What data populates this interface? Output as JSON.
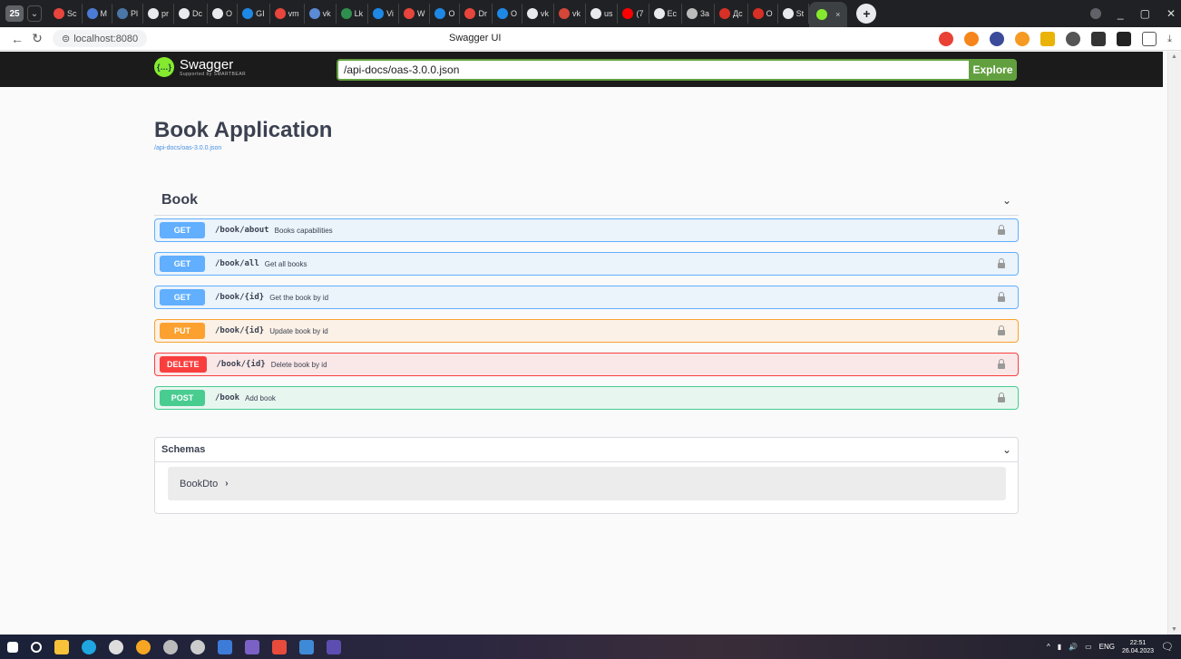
{
  "browser": {
    "tab_badge": "25",
    "tabs": [
      {
        "label": "Sc",
        "color": "#e8453c"
      },
      {
        "label": "M",
        "color": "#4a7bd6"
      },
      {
        "label": "Pl",
        "color": "#4a76a8"
      },
      {
        "label": "pr",
        "color": "#e8eaed"
      },
      {
        "label": "Dc",
        "color": "#e8eaed"
      },
      {
        "label": "O",
        "color": "#e8eaed"
      },
      {
        "label": "GI",
        "color": "#1e88e5"
      },
      {
        "label": "vm",
        "color": "#e8453c"
      },
      {
        "label": "vk",
        "color": "#5b8ad6"
      },
      {
        "label": "Lk",
        "color": "#2f8f4e"
      },
      {
        "label": "Vi",
        "color": "#1e88e5"
      },
      {
        "label": "W",
        "color": "#e8453c"
      },
      {
        "label": "O",
        "color": "#1e88e5"
      },
      {
        "label": "Dr",
        "color": "#e8453c"
      },
      {
        "label": "O",
        "color": "#1e88e5"
      },
      {
        "label": "vk",
        "color": "#e8eaed"
      },
      {
        "label": "vk",
        "color": "#d44638"
      },
      {
        "label": "us",
        "color": "#e8eaed"
      },
      {
        "label": "(7",
        "color": "#ff0000"
      },
      {
        "label": "Ec",
        "color": "#e8eaed"
      },
      {
        "label": "3a",
        "color": "#bbbbbb"
      },
      {
        "label": "Дс",
        "color": "#d93025"
      },
      {
        "label": "O",
        "color": "#d93025"
      },
      {
        "label": "St",
        "color": "#e8eaed"
      }
    ],
    "active_tab_close": "×",
    "new_tab": "+",
    "url": "localhost:8080",
    "page_title": "Swagger UI",
    "window_controls": [
      "_",
      "▢",
      "✕"
    ]
  },
  "topbar": {
    "logo_text": "Swagger",
    "logo_sub": "Supported by SMARTBEAR",
    "spec_url": "/api-docs/oas-3.0.0.json",
    "explore_label": "Explore"
  },
  "info": {
    "title": "Book Application",
    "spec_link": "/api-docs/oas-3.0.0.json"
  },
  "tag": {
    "name": "Book",
    "operations": [
      {
        "method": "GET",
        "path": "/book/about",
        "summary": "Books capabilities"
      },
      {
        "method": "GET",
        "path": "/book/all",
        "summary": "Get all books"
      },
      {
        "method": "GET",
        "path": "/book/{id}",
        "summary": "Get the book by id"
      },
      {
        "method": "PUT",
        "path": "/book/{id}",
        "summary": "Update book by id"
      },
      {
        "method": "DELETE",
        "path": "/book/{id}",
        "summary": "Delete book by id"
      },
      {
        "method": "POST",
        "path": "/book",
        "summary": "Add book"
      }
    ]
  },
  "schemas": {
    "title": "Schemas",
    "models": [
      {
        "name": "BookDto",
        "arrow": "›"
      }
    ]
  },
  "taskbar": {
    "language": "ENG",
    "time": "22:51",
    "date": "26.04.2023"
  }
}
